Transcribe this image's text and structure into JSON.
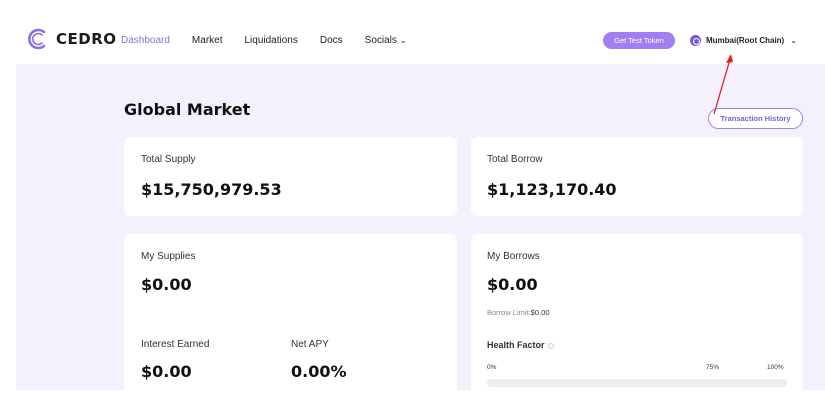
{
  "header": {
    "logo_text": "CEDRO",
    "nav": [
      {
        "label": "Dashboard",
        "active": true
      },
      {
        "label": "Market"
      },
      {
        "label": "Liquidations"
      },
      {
        "label": "Docs"
      },
      {
        "label": "Socials",
        "dropdown": true
      }
    ],
    "test_token_label": "Get Test Token",
    "network_label": "Mumbai(Root Chain)"
  },
  "main": {
    "title": "Global Market",
    "tx_history_label": "Transaction History",
    "total_supply": {
      "label": "Total Supply",
      "value": "$15,750,979.53"
    },
    "total_borrow": {
      "label": "Total Borrow",
      "value": "$1,123,170.40"
    },
    "my_supplies": {
      "label": "My Supplies",
      "value": "$0.00",
      "interest_label": "Interest Earned",
      "interest_value": "$0.00",
      "apy_label": "Net APY",
      "apy_value": "0.00%"
    },
    "my_borrows": {
      "label": "My Borrows",
      "value": "$0.00",
      "limit_label": "Borrow Limit:",
      "limit_value": "$0.00",
      "health_label": "Health Factor",
      "ticks": [
        "0%",
        "75%",
        "100%"
      ]
    }
  },
  "colors": {
    "accent": "#9f7ff1",
    "background_panel": "#f4f1fc",
    "arrow": "#e0201b"
  }
}
